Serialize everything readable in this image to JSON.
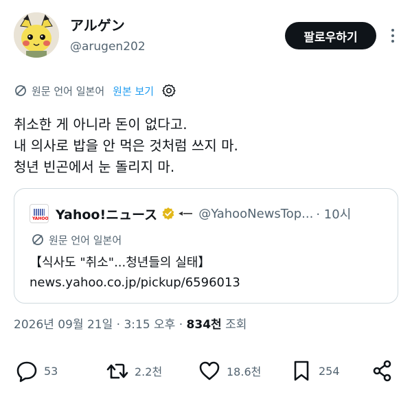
{
  "user": {
    "display_name": "アルゲン",
    "handle": "@arugen202",
    "avatar_icon": "pichu-avatar-icon"
  },
  "header": {
    "follow_label": "팔로우하기",
    "more_icon": "more-icon"
  },
  "translation": {
    "label": "원문 언어 일본어",
    "show_original": "원본 보기",
    "settings_icon": "gear-icon"
  },
  "tweet": {
    "lines": [
      "취소한 게 아니라 돈이 없다고.",
      "내 의사로 밥을 안 먹은 것처럼 쓰지 마.",
      "청년 빈곤에서 눈 돌리지 마."
    ]
  },
  "quote": {
    "name": "Yahoo!ニュース",
    "handle": "@YahooNewsTop...",
    "time": "· 10시",
    "translation_label": "원문 언어 일본어",
    "line1": "【식사도 \"취소\"...청년들의 실태】",
    "line2": "news.yahoo.co.jp/pickup/6596013"
  },
  "meta": {
    "timestamp": "2026년 09월 21일 · 3:15 오후 · ",
    "views_count": "834천",
    "views_label": " 조회"
  },
  "actions": {
    "replies": "53",
    "retweets": "2.2천",
    "likes": "18.6천",
    "bookmarks": "254"
  },
  "colors": {
    "accent": "#1d9bf0",
    "text": "#0f1419",
    "secondary": "#536471",
    "border": "#cfd9de"
  }
}
